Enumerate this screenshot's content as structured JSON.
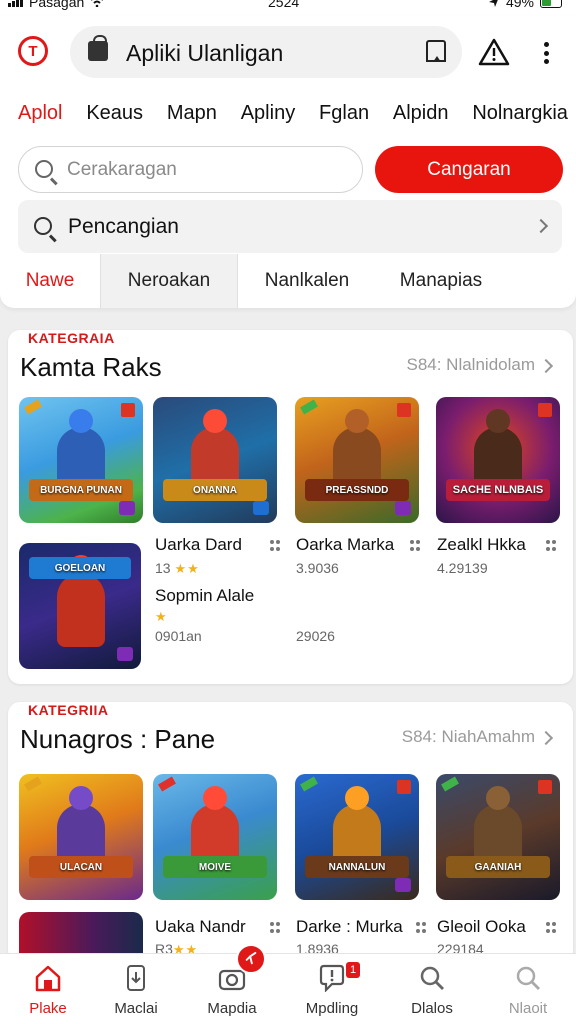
{
  "status_bar": {
    "carrier": "Pasagan",
    "time": "2524",
    "battery": "49%"
  },
  "header": {
    "title": "Apliki Ulanligan"
  },
  "categories": [
    "Aplol",
    "Keaus",
    "Mapn",
    "Apliny",
    "Fglan",
    "Alpidn",
    "Nolnargkia"
  ],
  "search": {
    "placeholder": "Cerakaragan",
    "button_label": "Cangaran",
    "secondary_text": "Pencangian"
  },
  "sub_tabs": [
    "Nawe",
    "Neroakan",
    "Nanlkalen",
    "Manapias"
  ],
  "sections": [
    {
      "label": "KATEGRAIA",
      "title": "Kamta Raks",
      "see_all": "S84: Nlalnidolam",
      "thumb_titles": [
        "BURGNA PUNAN",
        "ONANNA",
        "PREASSNDD",
        "SACHE NLNBAIS",
        "GOELOAN"
      ],
      "apps": [
        {
          "name": "Uarka Dard",
          "meta": "13",
          "stars": "★★"
        },
        {
          "name": "Oarka Marka",
          "meta": "3.9036"
        },
        {
          "name": "Zealkl Hkka",
          "meta": "4.29139"
        },
        {
          "name": "Sopmin Alale",
          "meta": "0901an",
          "stars": "★"
        },
        {
          "name": "",
          "meta": "29026"
        }
      ]
    },
    {
      "label": "KATEGRIIA",
      "title": "Nunagros : Pane",
      "see_all": "S84: NiahAmahm",
      "thumb_titles": [
        "ULACAN",
        "MOIVE",
        "NANNALUN",
        "GAANIAH"
      ],
      "apps": [
        {
          "name": "Uaka Nandr",
          "meta": "R3",
          "stars": "★★"
        },
        {
          "name": "Darke : Murka",
          "meta": "1.8936"
        },
        {
          "name": "Gleoil Ooka",
          "meta": "229184"
        }
      ]
    }
  ],
  "bottom_nav": [
    "Plake",
    "Maclai",
    "Mapdia",
    "Mpdling",
    "Dlalos",
    "Nlaoit"
  ],
  "bottom_nav_badge": "1",
  "colors": {
    "accent": "#e01818",
    "star": "#f2b21b"
  }
}
